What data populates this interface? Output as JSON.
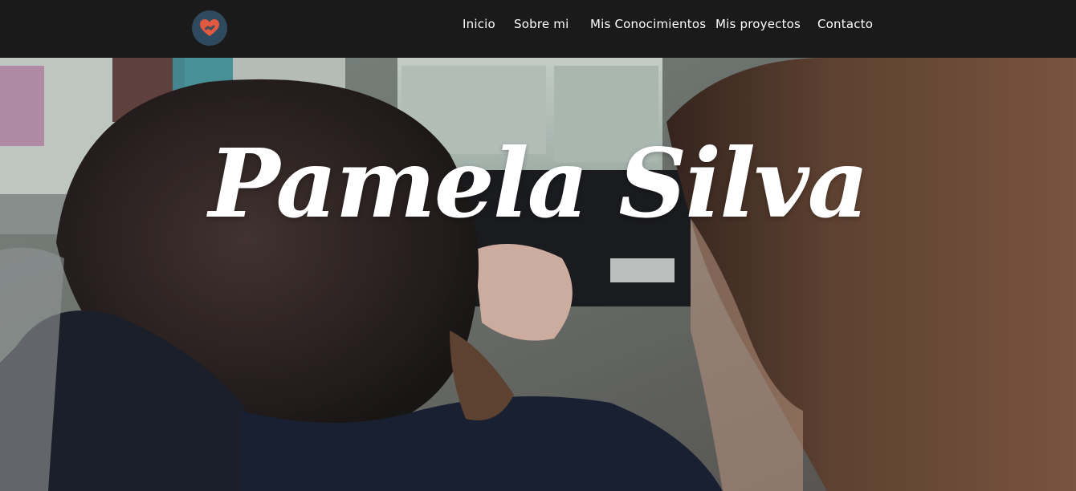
{
  "nav": {
    "logo_icon": "heart-hands-icon",
    "items": [
      "Inicio",
      "Sobre mi",
      "Mis Conocimientos",
      "Mis proyectos",
      "Contacto"
    ]
  },
  "hero": {
    "title": "Pamela Silva",
    "background": "photo of two people working at a laptop"
  },
  "colors": {
    "navbar": "#1a1a1a",
    "logo_bg": "#2f4a5e",
    "logo_heart": "#e2593f",
    "text": "#ffffff"
  }
}
